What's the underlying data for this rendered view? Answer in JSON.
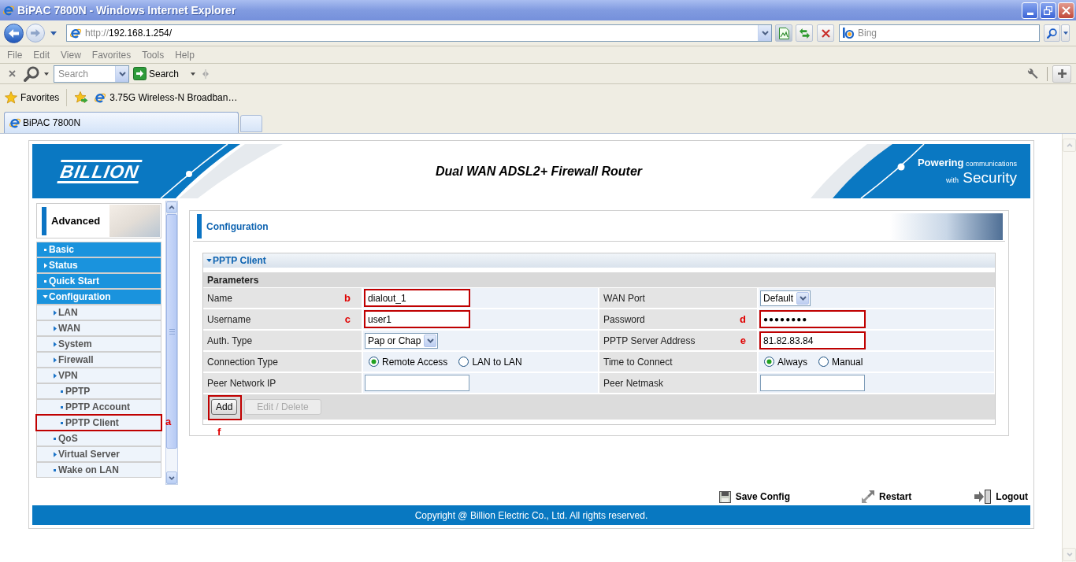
{
  "window": {
    "title": "BiPAC 7800N - Windows Internet Explorer"
  },
  "address_bar": {
    "scheme": "http://",
    "address": "192.168.1.254/"
  },
  "search_box": {
    "placeholder": "Bing"
  },
  "menu_bar": [
    "File",
    "Edit",
    "View",
    "Favorites",
    "Tools",
    "Help"
  ],
  "toolbar": {
    "search_field": {
      "placeholder": "Search"
    },
    "search_button": "Search"
  },
  "favorites_bar": {
    "label": "Favorites",
    "links": [
      "3.75G Wireless-N Broadban…"
    ]
  },
  "tabs": [
    {
      "label": "BiPAC 7800N",
      "selected": true
    }
  ],
  "page": {
    "header": {
      "logo": "BILLION",
      "title": "Dual WAN ADSL2+ Firewall Router",
      "slogan": "Powering communications with Security"
    },
    "sidebar": {
      "title": "Advanced",
      "menu": [
        {
          "label": "Basic",
          "kind": "link"
        },
        {
          "label": "Status",
          "kind": "folder",
          "expanded": false
        },
        {
          "label": "Quick Start",
          "kind": "link"
        },
        {
          "label": "Configuration",
          "kind": "folder",
          "expanded": true,
          "children": [
            {
              "label": "LAN",
              "kind": "folder",
              "expanded": false
            },
            {
              "label": "WAN",
              "kind": "folder",
              "expanded": false
            },
            {
              "label": "System",
              "kind": "folder",
              "expanded": false
            },
            {
              "label": "Firewall",
              "kind": "folder",
              "expanded": false
            },
            {
              "label": "VPN",
              "kind": "folder",
              "expanded": false,
              "children": [
                {
                  "label": "PPTP",
                  "kind": "link"
                },
                {
                  "label": "PPTP Account",
                  "kind": "link"
                },
                {
                  "label": "PPTP Client",
                  "kind": "link",
                  "marker": "a"
                }
              ]
            },
            {
              "label": "QoS",
              "kind": "link"
            },
            {
              "label": "Virtual Server",
              "kind": "folder",
              "expanded": false
            },
            {
              "label": "Wake on LAN",
              "kind": "link"
            }
          ]
        }
      ]
    },
    "panel": {
      "title": "Configuration",
      "section": {
        "title": "PPTP Client",
        "expanded": true,
        "subheading": "Parameters",
        "rows": [
          {
            "fields": [
              {
                "label": "Name",
                "marker": "b",
                "control": {
                  "kind": "text",
                  "value": "dialout_1"
                }
              },
              {
                "label": "WAN Port",
                "control": {
                  "kind": "select",
                  "value": "Default"
                }
              }
            ]
          },
          {
            "fields": [
              {
                "label": "Username",
                "marker": "c",
                "control": {
                  "kind": "text",
                  "value": "user1"
                }
              },
              {
                "label": "Password",
                "marker": "d",
                "control": {
                  "kind": "password",
                  "value": "●●●●●●●●"
                }
              }
            ]
          },
          {
            "fields": [
              {
                "label": "Auth. Type",
                "control": {
                  "kind": "select",
                  "value": "Pap or Chap"
                }
              },
              {
                "label": "PPTP Server Address",
                "marker": "e",
                "control": {
                  "kind": "text",
                  "value": "81.82.83.84"
                }
              }
            ]
          },
          {
            "fields": [
              {
                "label": "Connection Type",
                "control": {
                  "kind": "radio",
                  "options": [
                    {
                      "label": "Remote Access",
                      "selected": true
                    },
                    {
                      "label": "LAN to LAN",
                      "selected": false
                    }
                  ]
                }
              },
              {
                "label": "Time to Connect",
                "control": {
                  "kind": "radio",
                  "options": [
                    {
                      "label": "Always",
                      "selected": true
                    },
                    {
                      "label": "Manual",
                      "selected": false
                    }
                  ]
                }
              }
            ]
          },
          {
            "fields": [
              {
                "label": "Peer Network IP",
                "control": {
                  "kind": "text"
                }
              },
              {
                "label": "Peer Netmask",
                "control": {
                  "kind": "text"
                }
              }
            ]
          }
        ],
        "buttons": [
          {
            "label": "Add",
            "disabled": false,
            "marker": "f"
          },
          {
            "label": "Edit / Delete",
            "disabled": true
          }
        ]
      }
    },
    "actions": [
      "Save Config",
      "Restart",
      "Logout"
    ],
    "footer": "Copyright @ Billion Electric Co., Ltd. All rights reserved."
  }
}
